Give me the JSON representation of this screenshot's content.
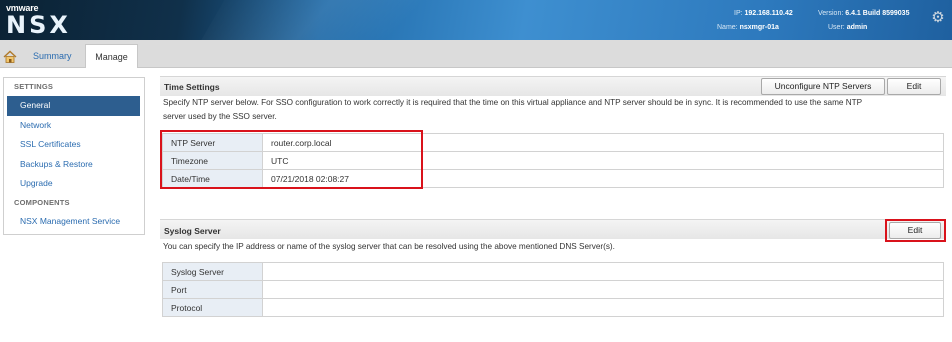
{
  "header": {
    "brand_small": "vmware",
    "brand_large": "NSX",
    "ip_label": "IP:",
    "ip_value": "192.168.110.42",
    "version_label": "Version:",
    "version_value": "6.4.1 Build 8599035",
    "name_label": "Name:",
    "name_value": "nsxmgr-01a",
    "user_label": "User:",
    "user_value": "admin",
    "settings_icon": "gear-icon"
  },
  "tabs": {
    "home_icon": "home-icon",
    "items": [
      {
        "label": "Summary",
        "active": false
      },
      {
        "label": "Manage",
        "active": true
      }
    ]
  },
  "sidebar": {
    "settings_heading": "SETTINGS",
    "settings_items": [
      {
        "label": "General",
        "active": true
      },
      {
        "label": "Network"
      },
      {
        "label": "SSL Certificates"
      },
      {
        "label": "Backups & Restore"
      },
      {
        "label": "Upgrade"
      }
    ],
    "components_heading": "COMPONENTS",
    "components_items": [
      {
        "label": "NSX Management Service"
      }
    ]
  },
  "time_settings": {
    "title": "Time Settings",
    "unconfigure_button": "Unconfigure NTP Servers",
    "edit_button": "Edit",
    "description_line1": "Specify NTP server below. For SSO configuration to work correctly it is required that the time on this virtual appliance and NTP server should be in sync. It is recommended to use the same NTP",
    "description_line2": "server used by the SSO server.",
    "rows": [
      {
        "label": "NTP Server",
        "value": "router.corp.local"
      },
      {
        "label": "Timezone",
        "value": "UTC"
      },
      {
        "label": "Date/Time",
        "value": "07/21/2018 02:08:27"
      }
    ]
  },
  "syslog": {
    "title": "Syslog Server",
    "edit_button": "Edit",
    "description": "You can specify the IP address or name of the syslog server that can be resolved using the above mentioned DNS Server(s).",
    "rows": [
      {
        "label": "Syslog Server",
        "value": ""
      },
      {
        "label": "Port",
        "value": ""
      },
      {
        "label": "Protocol",
        "value": ""
      }
    ]
  },
  "colors": {
    "highlight": "#d9121b",
    "link": "#2b6cb0",
    "active_nav": "#2d5e8f"
  }
}
